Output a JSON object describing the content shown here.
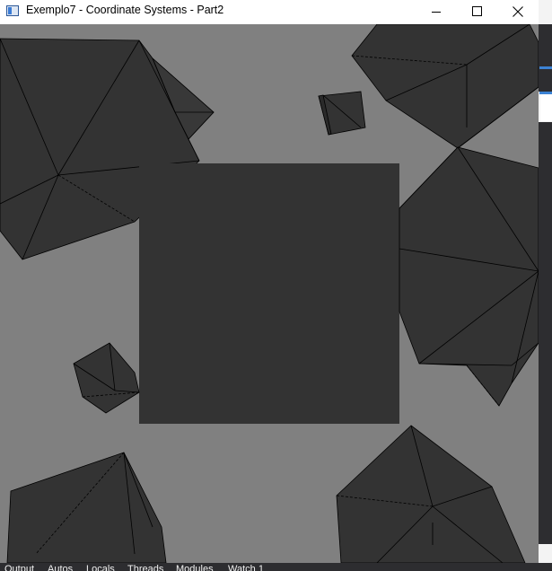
{
  "window": {
    "title": "Exemplo7 - Coordinate Systems - Part2",
    "app_icon": "app-window-icon",
    "controls": {
      "minimize_icon": "minimize-icon",
      "maximize_icon": "maximize-icon",
      "close_icon": "close-icon"
    }
  },
  "scene": {
    "background_color": "#808080",
    "object_color": "#333333",
    "edge_color": "#000000"
  },
  "bottom_tabs": [
    "Output",
    "Autos",
    "Locals",
    "Threads",
    "Modules",
    "Watch 1"
  ],
  "colors": {
    "ide_dark": "#2d2d30",
    "ide_accent": "#3c82d4"
  }
}
